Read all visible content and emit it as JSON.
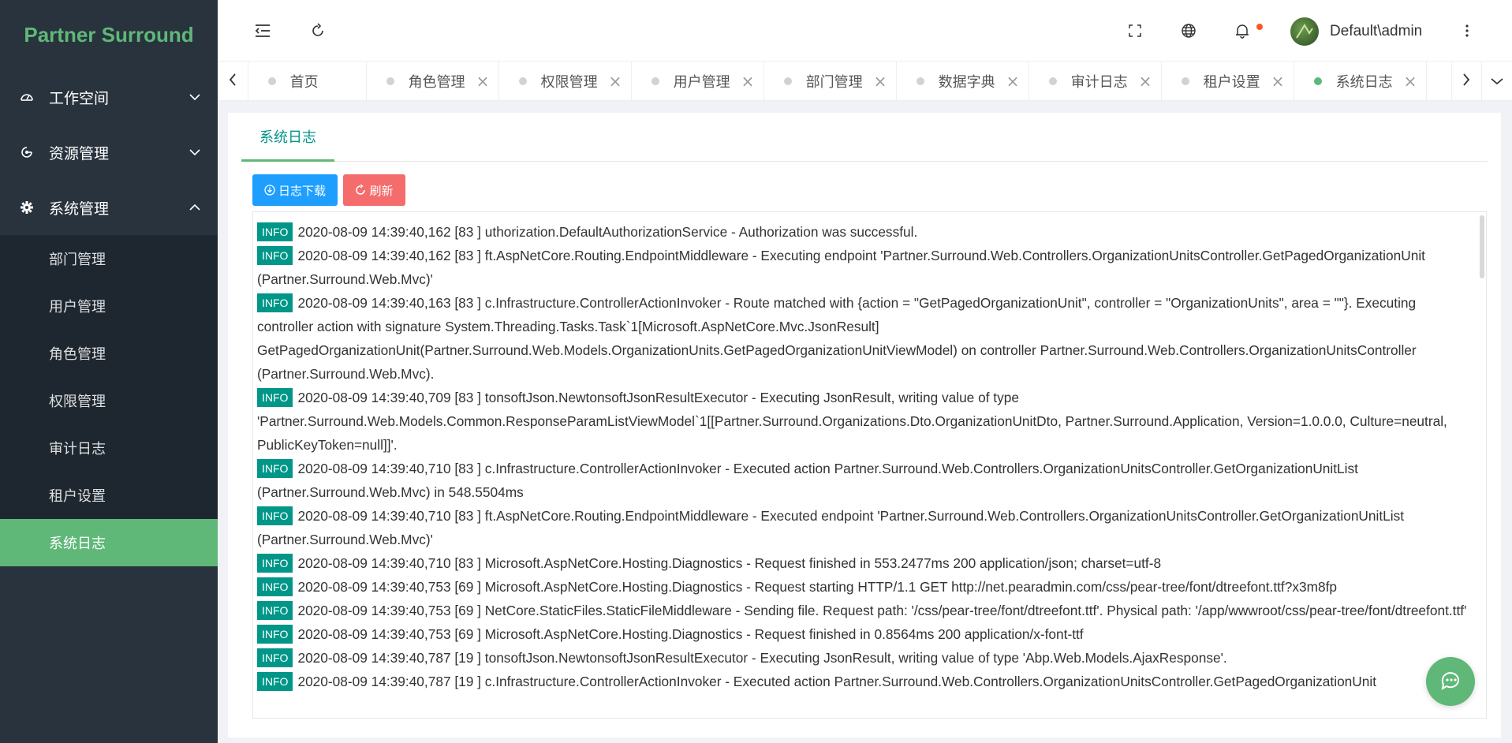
{
  "app": {
    "title": "Partner Surround"
  },
  "sidebar": {
    "groups": [
      {
        "label": "工作空间",
        "icon": "dashboard-icon",
        "expanded": false
      },
      {
        "label": "资源管理",
        "icon": "resource-icon",
        "expanded": false
      },
      {
        "label": "系统管理",
        "icon": "gear-icon",
        "expanded": true
      }
    ],
    "sub_items": [
      {
        "label": "部门管理"
      },
      {
        "label": "用户管理"
      },
      {
        "label": "角色管理"
      },
      {
        "label": "权限管理"
      },
      {
        "label": "审计日志"
      },
      {
        "label": "租户设置"
      },
      {
        "label": "系统日志",
        "active": true
      }
    ]
  },
  "header": {
    "user": "Default\\admin"
  },
  "tabs": [
    {
      "label": "首页",
      "closable": false
    },
    {
      "label": "角色管理",
      "closable": true
    },
    {
      "label": "权限管理",
      "closable": true
    },
    {
      "label": "用户管理",
      "closable": true
    },
    {
      "label": "部门管理",
      "closable": true
    },
    {
      "label": "数据字典",
      "closable": true
    },
    {
      "label": "审计日志",
      "closable": true
    },
    {
      "label": "租户设置",
      "closable": true
    },
    {
      "label": "系统日志",
      "closable": true,
      "active": true
    }
  ],
  "page": {
    "tab_title": "系统日志",
    "download_label": "日志下载",
    "refresh_label": "刷新"
  },
  "logs": [
    {
      "level": "INFO",
      "text": "2020-08-09 14:39:40,162 [83 ] uthorization.DefaultAuthorizationService - Authorization was successful."
    },
    {
      "level": "INFO",
      "text": "2020-08-09 14:39:40,162 [83 ] ft.AspNetCore.Routing.EndpointMiddleware - Executing endpoint 'Partner.Surround.Web.Controllers.OrganizationUnitsController.GetPagedOrganizationUnit (Partner.Surround.Web.Mvc)'"
    },
    {
      "level": "INFO",
      "text": "2020-08-09 14:39:40,163 [83 ] c.Infrastructure.ControllerActionInvoker - Route matched with {action = \"GetPagedOrganizationUnit\", controller = \"OrganizationUnits\", area = \"\"}. Executing controller action with signature System.Threading.Tasks.Task`1[Microsoft.AspNetCore.Mvc.JsonResult] GetPagedOrganizationUnit(Partner.Surround.Web.Models.OrganizationUnits.GetPagedOrganizationUnitViewModel) on controller Partner.Surround.Web.Controllers.OrganizationUnitsController (Partner.Surround.Web.Mvc)."
    },
    {
      "level": "INFO",
      "text": "2020-08-09 14:39:40,709 [83 ] tonsoftJson.NewtonsoftJsonResultExecutor - Executing JsonResult, writing value of type 'Partner.Surround.Web.Models.Common.ResponseParamListViewModel`1[[Partner.Surround.Organizations.Dto.OrganizationUnitDto, Partner.Surround.Application, Version=1.0.0.0, Culture=neutral, PublicKeyToken=null]]'."
    },
    {
      "level": "INFO",
      "text": "2020-08-09 14:39:40,710 [83 ] c.Infrastructure.ControllerActionInvoker - Executed action Partner.Surround.Web.Controllers.OrganizationUnitsController.GetOrganizationUnitList (Partner.Surround.Web.Mvc) in 548.5504ms"
    },
    {
      "level": "INFO",
      "text": "2020-08-09 14:39:40,710 [83 ] ft.AspNetCore.Routing.EndpointMiddleware - Executed endpoint 'Partner.Surround.Web.Controllers.OrganizationUnitsController.GetOrganizationUnitList (Partner.Surround.Web.Mvc)'"
    },
    {
      "level": "INFO",
      "text": "2020-08-09 14:39:40,710 [83 ] Microsoft.AspNetCore.Hosting.Diagnostics - Request finished in 553.2477ms 200 application/json; charset=utf-8"
    },
    {
      "level": "INFO",
      "text": "2020-08-09 14:39:40,753 [69 ] Microsoft.AspNetCore.Hosting.Diagnostics - Request starting HTTP/1.1 GET http://net.pearadmin.com/css/pear-tree/font/dtreefont.ttf?x3m8fp"
    },
    {
      "level": "INFO",
      "text": "2020-08-09 14:39:40,753 [69 ] NetCore.StaticFiles.StaticFileMiddleware - Sending file. Request path: '/css/pear-tree/font/dtreefont.ttf'. Physical path: '/app/wwwroot/css/pear-tree/font/dtreefont.ttf'"
    },
    {
      "level": "INFO",
      "text": "2020-08-09 14:39:40,753 [69 ] Microsoft.AspNetCore.Hosting.Diagnostics - Request finished in 0.8564ms 200 application/x-font-ttf"
    },
    {
      "level": "INFO",
      "text": "2020-08-09 14:39:40,787 [19 ] tonsoftJson.NewtonsoftJsonResultExecutor - Executing JsonResult, writing value of type 'Abp.Web.Models.AjaxResponse'."
    },
    {
      "level": "INFO",
      "text": "2020-08-09 14:39:40,787 [19 ] c.Infrastructure.ControllerActionInvoker - Executed action Partner.Surround.Web.Controllers.OrganizationUnitsController.GetPagedOrganizationUnit"
    }
  ],
  "colors": {
    "sidebar_bg": "#28333e",
    "submenu_bg": "#1e2730",
    "accent_green": "#5fb878",
    "info_badge": "#009688",
    "download_btn": "#1e9fff",
    "refresh_btn": "#f56c6c"
  }
}
